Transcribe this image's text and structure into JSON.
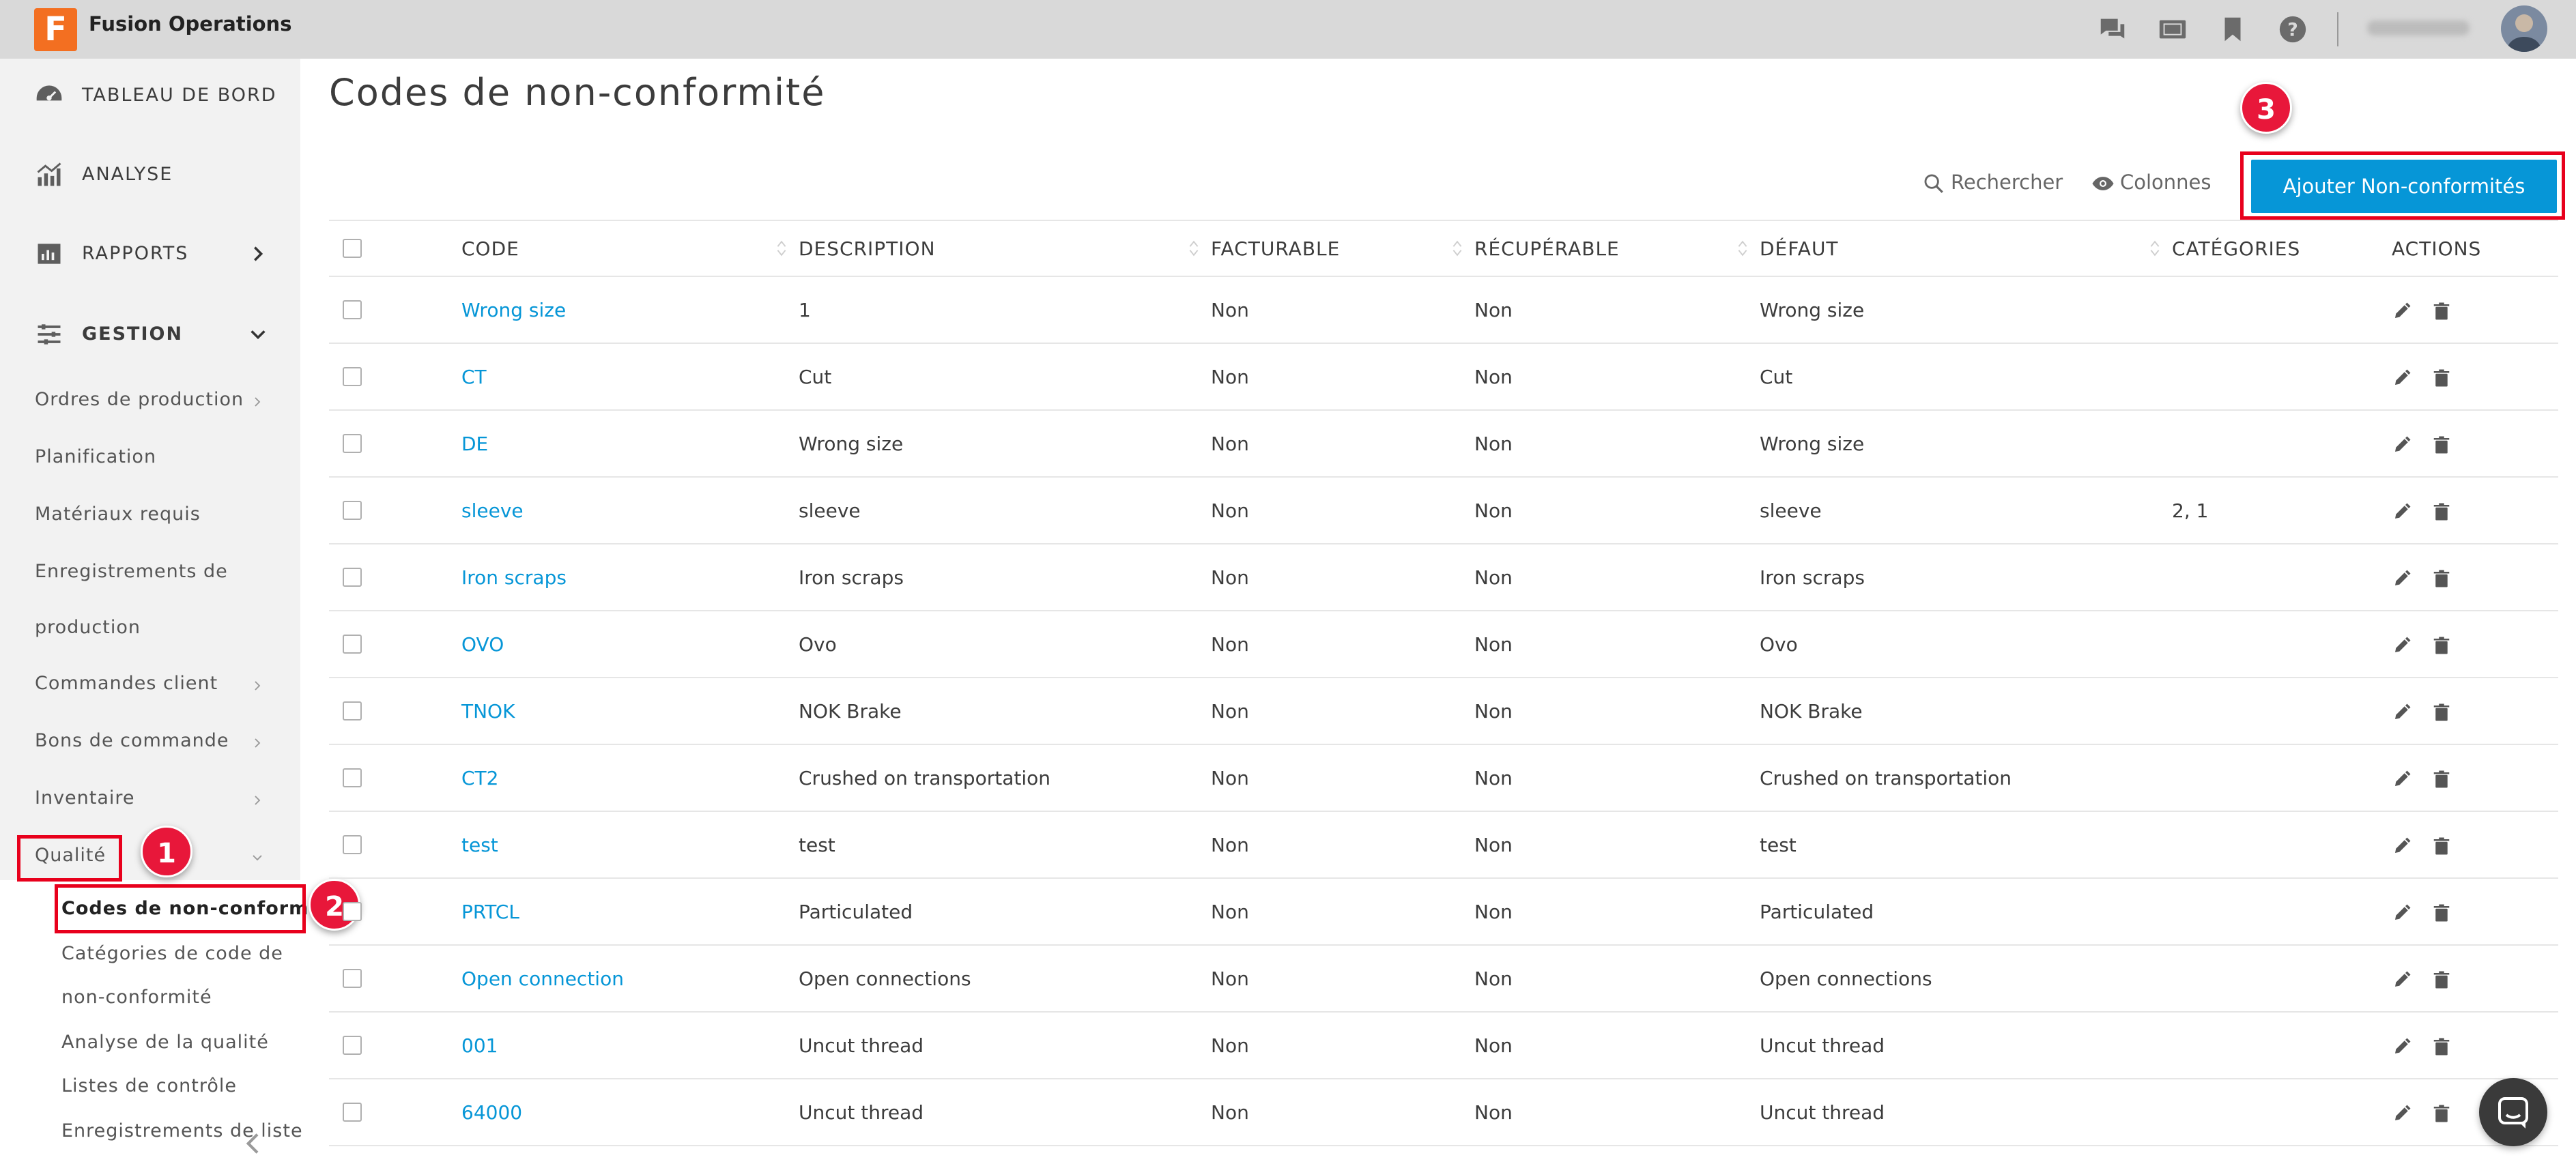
{
  "app": {
    "logo_letter": "F",
    "title": "Fusion Operations"
  },
  "colors": {
    "accent": "#0696d7",
    "brand": "#f36f21",
    "highlight": "#e8001c"
  },
  "header_icons": [
    "chat-icon",
    "tablet-icon",
    "bookmark-icon",
    "help-icon"
  ],
  "sidebar": {
    "dashboard": "TABLEAU DE BORD",
    "analysis": "ANALYSE",
    "reports": "RAPPORTS",
    "management": "GESTION",
    "sub": {
      "production_orders": "Ordres de production",
      "planning": "Planification",
      "required_materials": "Matériaux requis",
      "production_records_1": "Enregistrements de",
      "production_records_2": "production",
      "client_orders": "Commandes client",
      "purchase_orders": "Bons de commande",
      "inventory": "Inventaire",
      "quality": "Qualité"
    },
    "quality_sub": {
      "nc_codes": "Codes de non-conformité",
      "nc_categories_1": "Catégories de code de",
      "nc_categories_2": "non-conformité",
      "quality_analysis": "Analyse de la qualité",
      "checklists": "Listes de contrôle",
      "list_records": "Enregistrements de liste"
    }
  },
  "badges": {
    "b1": "1",
    "b2": "2",
    "b3": "3"
  },
  "page": {
    "title": "Codes de non-conformité",
    "search_label": "Rechercher",
    "columns_label": "Colonnes",
    "add_button": "Ajouter Non-conformités"
  },
  "table": {
    "headers": {
      "code": "CODE",
      "description": "DESCRIPTION",
      "billable": "FACTURABLE",
      "recoverable": "RÉCUPÉRABLE",
      "defect": "DÉFAUT",
      "categories": "CATÉGORIES",
      "actions": "ACTIONS"
    },
    "rows": [
      {
        "code": "Wrong size",
        "description": "1",
        "billable": "Non",
        "recoverable": "Non",
        "defect": "Wrong size",
        "categories": ""
      },
      {
        "code": "CT",
        "description": "Cut",
        "billable": "Non",
        "recoverable": "Non",
        "defect": "Cut",
        "categories": ""
      },
      {
        "code": "DE",
        "description": "Wrong size",
        "billable": "Non",
        "recoverable": "Non",
        "defect": "Wrong size",
        "categories": ""
      },
      {
        "code": "sleeve",
        "description": "sleeve",
        "billable": "Non",
        "recoverable": "Non",
        "defect": "sleeve",
        "categories": "2, 1"
      },
      {
        "code": "Iron scraps",
        "description": "Iron scraps",
        "billable": "Non",
        "recoverable": "Non",
        "defect": "Iron scraps",
        "categories": ""
      },
      {
        "code": "OVO",
        "description": "Ovo",
        "billable": "Non",
        "recoverable": "Non",
        "defect": "Ovo",
        "categories": ""
      },
      {
        "code": "TNOK",
        "description": "NOK Brake",
        "billable": "Non",
        "recoverable": "Non",
        "defect": "NOK Brake",
        "categories": ""
      },
      {
        "code": "CT2",
        "description": "Crushed on transportation",
        "billable": "Non",
        "recoverable": "Non",
        "defect": "Crushed on transportation",
        "categories": ""
      },
      {
        "code": "test",
        "description": "test",
        "billable": "Non",
        "recoverable": "Non",
        "defect": "test",
        "categories": ""
      },
      {
        "code": "PRTCL",
        "description": "Particulated",
        "billable": "Non",
        "recoverable": "Non",
        "defect": "Particulated",
        "categories": ""
      },
      {
        "code": "Open connection",
        "description": "Open connections",
        "billable": "Non",
        "recoverable": "Non",
        "defect": "Open connections",
        "categories": ""
      },
      {
        "code": "001",
        "description": "Uncut thread",
        "billable": "Non",
        "recoverable": "Non",
        "defect": "Uncut thread",
        "categories": ""
      },
      {
        "code": "64000",
        "description": "Uncut thread",
        "billable": "Non",
        "recoverable": "Non",
        "defect": "Uncut thread",
        "categories": ""
      }
    ]
  }
}
